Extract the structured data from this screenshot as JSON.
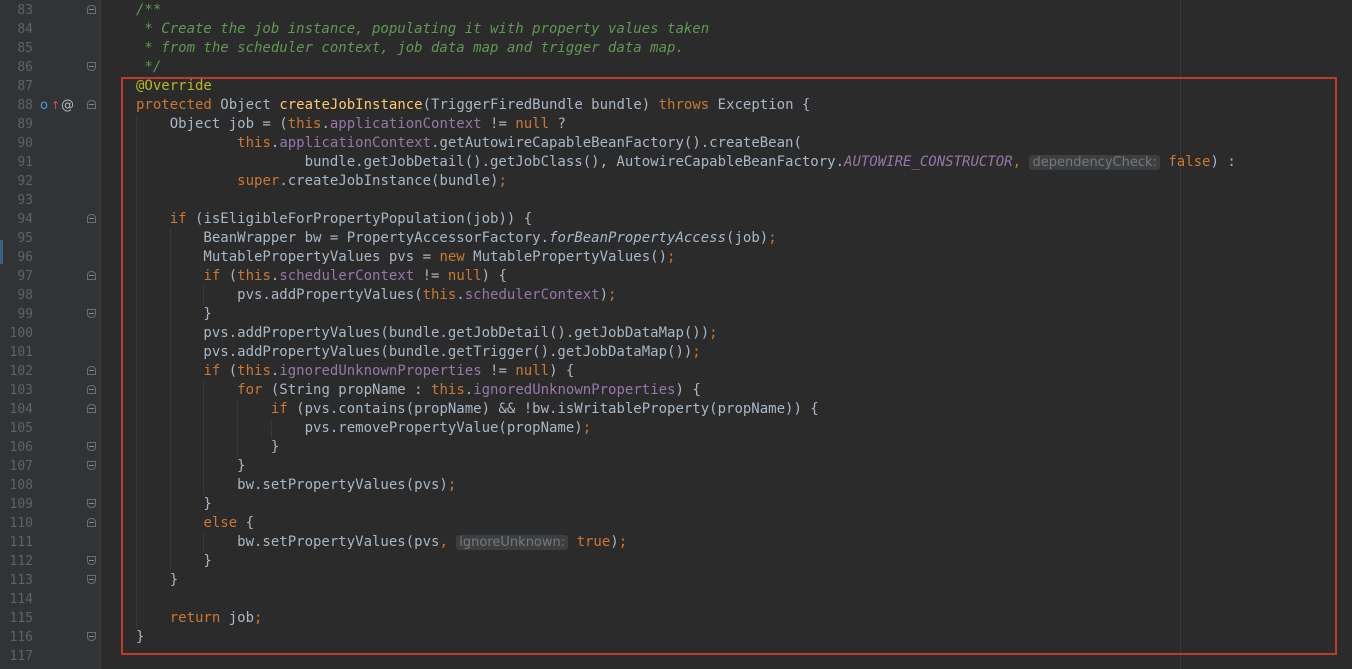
{
  "editor": {
    "language": "java",
    "colors": {
      "background": "#2b2b2b",
      "gutter": "#313335",
      "keyword": "#cc7832",
      "comment": "#629755",
      "annotation": "#bbb529",
      "method": "#ffc66d",
      "field": "#9876aa",
      "text": "#a9b7c6",
      "selection_box": "#c0392b"
    },
    "gutter_icons": {
      "override": "override-method-icon",
      "override_arrow": "implements-up-arrow-icon",
      "annotation": "annotation-at-icon",
      "override_glyph": "o",
      "arrow_glyph": "↑",
      "at_glyph": "@"
    },
    "lines": [
      {
        "n": "83",
        "tokens": [
          {
            "t": "/**",
            "c": "cm"
          }
        ]
      },
      {
        "n": "84",
        "tokens": [
          {
            "t": " * Create the job instance, populating it with property values taken",
            "c": "cm"
          }
        ]
      },
      {
        "n": "85",
        "tokens": [
          {
            "t": " * from the scheduler context, job data map and trigger data map.",
            "c": "cm"
          }
        ]
      },
      {
        "n": "86",
        "tokens": [
          {
            "t": " */",
            "c": "cm"
          }
        ]
      },
      {
        "n": "87",
        "tokens": [
          {
            "t": "@Override",
            "c": "an"
          }
        ]
      },
      {
        "n": "88",
        "tokens": [
          {
            "t": "protected ",
            "c": "kw"
          },
          {
            "t": "Object "
          },
          {
            "t": "createJobInstance",
            "c": "fn"
          },
          {
            "t": "(TriggerFiredBundle bundle) "
          },
          {
            "t": "throws ",
            "c": "kw"
          },
          {
            "t": "Exception {"
          }
        ]
      },
      {
        "n": "89",
        "tokens": [
          {
            "t": "    Object job = ("
          },
          {
            "t": "this",
            "c": "kw"
          },
          {
            "t": "."
          },
          {
            "t": "applicationContext",
            "c": "fld"
          },
          {
            "t": " != "
          },
          {
            "t": "null",
            "c": "kw"
          },
          {
            "t": " ?"
          }
        ]
      },
      {
        "n": "90",
        "tokens": [
          {
            "t": "            "
          },
          {
            "t": "this",
            "c": "kw"
          },
          {
            "t": "."
          },
          {
            "t": "applicationContext",
            "c": "fld"
          },
          {
            "t": ".getAutowireCapableBeanFactory().createBean("
          }
        ]
      },
      {
        "n": "91",
        "tokens": [
          {
            "t": "                    bundle.getJobDetail().getJobClass(), AutowireCapableBeanFactory."
          },
          {
            "t": "AUTOWIRE_CONSTRUCTOR",
            "c": "st"
          },
          {
            "t": ", ",
            "c": "kw"
          },
          {
            "t": "dependencyCheck:",
            "c": "hint"
          },
          {
            "t": " "
          },
          {
            "t": "false",
            "c": "kw"
          },
          {
            "t": ") :"
          }
        ]
      },
      {
        "n": "92",
        "tokens": [
          {
            "t": "            "
          },
          {
            "t": "super",
            "c": "kw"
          },
          {
            "t": ".createJobInstance(bundle)"
          },
          {
            "t": ";",
            "c": "kw"
          }
        ]
      },
      {
        "n": "93",
        "tokens": []
      },
      {
        "n": "94",
        "tokens": [
          {
            "t": "    "
          },
          {
            "t": "if ",
            "c": "kw"
          },
          {
            "t": "(isEligibleForPropertyPopulation(job)) {"
          }
        ]
      },
      {
        "n": "95",
        "tokens": [
          {
            "t": "        BeanWrapper bw = PropertyAccessorFactory."
          },
          {
            "t": "forBeanPropertyAccess",
            "c": "it"
          },
          {
            "t": "(job)"
          },
          {
            "t": ";",
            "c": "kw"
          }
        ]
      },
      {
        "n": "96",
        "tokens": [
          {
            "t": "        MutablePropertyValues pvs = "
          },
          {
            "t": "new ",
            "c": "kw"
          },
          {
            "t": "MutablePropertyValues()"
          },
          {
            "t": ";",
            "c": "kw"
          }
        ]
      },
      {
        "n": "97",
        "tokens": [
          {
            "t": "        "
          },
          {
            "t": "if ",
            "c": "kw"
          },
          {
            "t": "("
          },
          {
            "t": "this",
            "c": "kw"
          },
          {
            "t": "."
          },
          {
            "t": "schedulerContext",
            "c": "fld"
          },
          {
            "t": " != "
          },
          {
            "t": "null",
            "c": "kw"
          },
          {
            "t": ") {"
          }
        ]
      },
      {
        "n": "98",
        "tokens": [
          {
            "t": "            pvs.addPropertyValues("
          },
          {
            "t": "this",
            "c": "kw"
          },
          {
            "t": "."
          },
          {
            "t": "schedulerContext",
            "c": "fld"
          },
          {
            "t": ")"
          },
          {
            "t": ";",
            "c": "kw"
          }
        ]
      },
      {
        "n": "99",
        "tokens": [
          {
            "t": "        }"
          }
        ]
      },
      {
        "n": "100",
        "tokens": [
          {
            "t": "        pvs.addPropertyValues(bundle.getJobDetail().getJobDataMap())"
          },
          {
            "t": ";",
            "c": "kw"
          }
        ]
      },
      {
        "n": "101",
        "tokens": [
          {
            "t": "        pvs.addPropertyValues(bundle.getTrigger().getJobDataMap())"
          },
          {
            "t": ";",
            "c": "kw"
          }
        ]
      },
      {
        "n": "102",
        "tokens": [
          {
            "t": "        "
          },
          {
            "t": "if ",
            "c": "kw"
          },
          {
            "t": "("
          },
          {
            "t": "this",
            "c": "kw"
          },
          {
            "t": "."
          },
          {
            "t": "ignoredUnknownProperties",
            "c": "fld"
          },
          {
            "t": " != "
          },
          {
            "t": "null",
            "c": "kw"
          },
          {
            "t": ") {"
          }
        ]
      },
      {
        "n": "103",
        "tokens": [
          {
            "t": "            "
          },
          {
            "t": "for ",
            "c": "kw"
          },
          {
            "t": "(String propName : "
          },
          {
            "t": "this",
            "c": "kw"
          },
          {
            "t": "."
          },
          {
            "t": "ignoredUnknownProperties",
            "c": "fld"
          },
          {
            "t": ") {"
          }
        ]
      },
      {
        "n": "104",
        "tokens": [
          {
            "t": "                "
          },
          {
            "t": "if ",
            "c": "kw"
          },
          {
            "t": "(pvs.contains(propName) && !bw.isWritableProperty(propName)) {"
          }
        ]
      },
      {
        "n": "105",
        "tokens": [
          {
            "t": "                    pvs.removePropertyValue(propName)"
          },
          {
            "t": ";",
            "c": "kw"
          }
        ]
      },
      {
        "n": "106",
        "tokens": [
          {
            "t": "                }"
          }
        ]
      },
      {
        "n": "107",
        "tokens": [
          {
            "t": "            }"
          }
        ]
      },
      {
        "n": "108",
        "tokens": [
          {
            "t": "            bw.setPropertyValues(pvs)"
          },
          {
            "t": ";",
            "c": "kw"
          }
        ]
      },
      {
        "n": "109",
        "tokens": [
          {
            "t": "        }"
          }
        ]
      },
      {
        "n": "110",
        "tokens": [
          {
            "t": "        "
          },
          {
            "t": "else ",
            "c": "kw"
          },
          {
            "t": "{"
          }
        ]
      },
      {
        "n": "111",
        "tokens": [
          {
            "t": "            bw.setPropertyValues(pvs"
          },
          {
            "t": ", ",
            "c": "kw"
          },
          {
            "t": "ignoreUnknown:",
            "c": "hint"
          },
          {
            "t": " "
          },
          {
            "t": "true",
            "c": "kw"
          },
          {
            "t": ")"
          },
          {
            "t": ";",
            "c": "kw"
          }
        ]
      },
      {
        "n": "112",
        "tokens": [
          {
            "t": "        }"
          }
        ]
      },
      {
        "n": "113",
        "tokens": [
          {
            "t": "    }"
          }
        ]
      },
      {
        "n": "114",
        "tokens": []
      },
      {
        "n": "115",
        "tokens": [
          {
            "t": "    "
          },
          {
            "t": "return ",
            "c": "kw"
          },
          {
            "t": "job"
          },
          {
            "t": ";",
            "c": "kw"
          }
        ]
      },
      {
        "n": "116",
        "tokens": [
          {
            "t": "}"
          }
        ]
      },
      {
        "n": "117",
        "tokens": []
      }
    ]
  }
}
